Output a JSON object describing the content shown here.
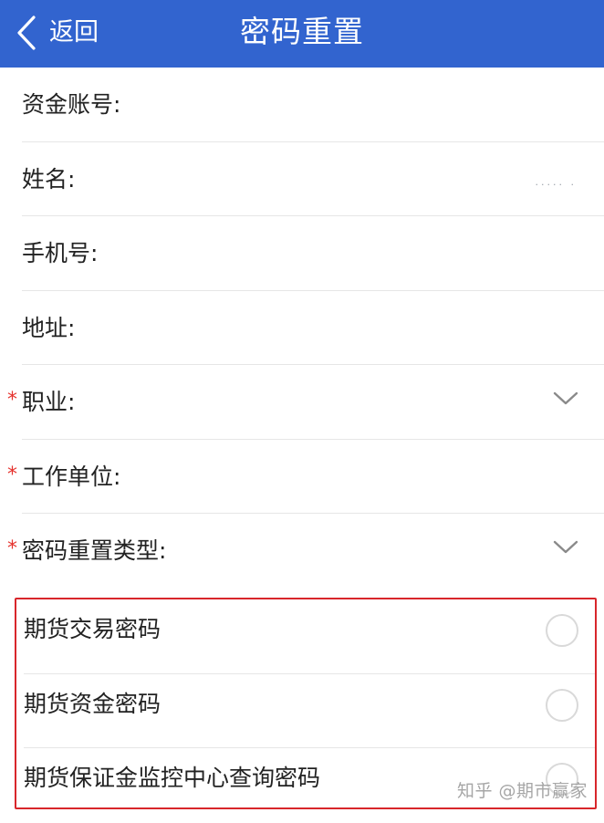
{
  "colors": {
    "header_bg": "#3264cf",
    "required_star": "#e5322d",
    "highlight_border": "#d8262b"
  },
  "header": {
    "back_label": "返回",
    "title": "密码重置",
    "back_icon": "chevron-left-icon"
  },
  "form": {
    "fund_account": {
      "label": "资金账号:"
    },
    "name": {
      "label": "姓名:",
      "masked_value": "·····  ·"
    },
    "phone": {
      "label": "手机号:"
    },
    "address": {
      "label": "地址:"
    },
    "occupation": {
      "label": "职业:",
      "required_mark": "*",
      "icon": "chevron-down-icon"
    },
    "employer": {
      "label": "工作单位:",
      "required_mark": "*"
    },
    "reset_type": {
      "label": "密码重置类型:",
      "required_mark": "*",
      "icon": "chevron-down-icon"
    }
  },
  "reset_options": [
    {
      "label": "期货交易密码",
      "selected": false
    },
    {
      "label": "期货资金密码",
      "selected": false
    },
    {
      "label": "期货保证金监控中心查询密码",
      "selected": false
    }
  ],
  "watermark": "知乎 @期市赢家"
}
